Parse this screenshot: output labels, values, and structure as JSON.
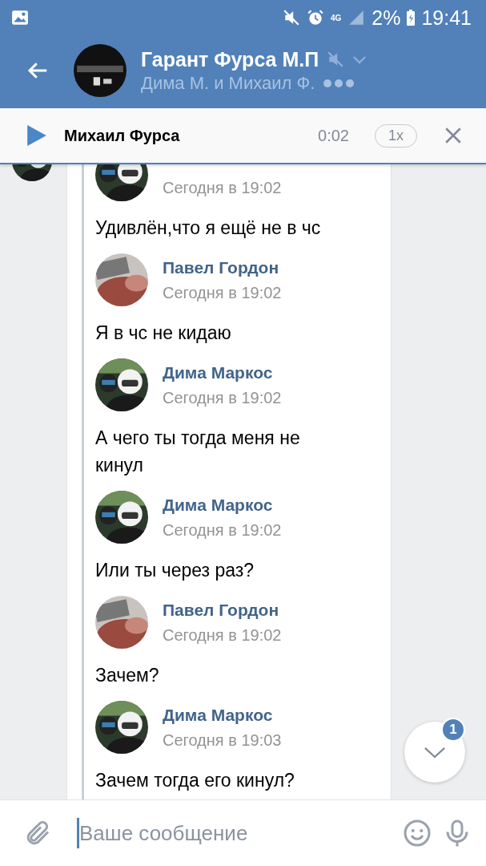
{
  "status_bar": {
    "battery": "2%",
    "time": "19:41",
    "network": "4G"
  },
  "header": {
    "title": "Гарант Фурса М.П",
    "subtitle": "Дима М. и Михаил Ф.",
    "muted": true
  },
  "player": {
    "name": "Михаил Фурса",
    "duration": "0:02",
    "speed": "1x"
  },
  "messages": [
    {
      "time": "Сегодня в 19:02",
      "text": "Удивлён,что я ещё не в чс"
    },
    {
      "name": "Павел Гордон",
      "time": "Сегодня в 19:02",
      "text": "Я в чс не кидаю"
    },
    {
      "name": "Дима Маркос",
      "time": "Сегодня в 19:02",
      "text": "А чего ты тогда меня не кинул"
    },
    {
      "name": "Дима Маркос",
      "time": "Сегодня в 19:02",
      "text": "Или ты через раз?"
    },
    {
      "name": "Павел Гордон",
      "time": "Сегодня в 19:02",
      "text": "Зачем?"
    },
    {
      "name": "Дима Маркос",
      "time": "Сегодня в 19:03",
      "text": "Зачем тогда его кинул?"
    }
  ],
  "scroll_button": {
    "badge": "1"
  },
  "composer": {
    "placeholder": "Ваше сообщение"
  }
}
